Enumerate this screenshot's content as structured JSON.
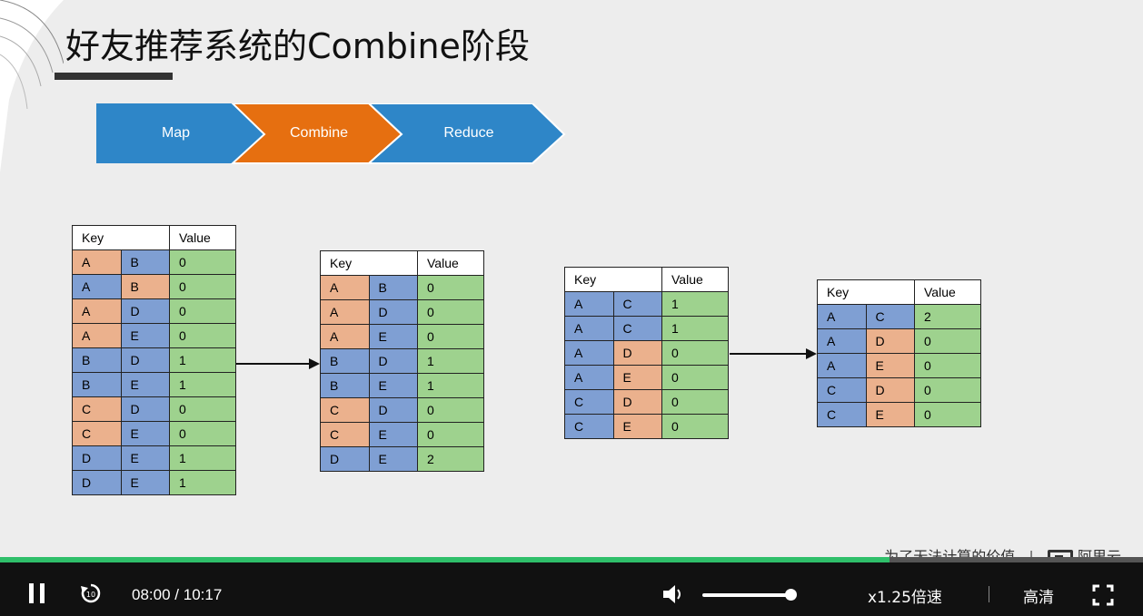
{
  "slide": {
    "title": "好友推荐系统的Combine阶段",
    "flow_steps": [
      "Map",
      "Combine",
      "Reduce"
    ],
    "colors": {
      "step_blue": "#2e86c8",
      "step_orange": "#e66f10",
      "cell_blue": "#7f9fd3",
      "cell_orange": "#ebb18d",
      "cell_green": "#9ed28e"
    },
    "tables": [
      {
        "header_key": "Key",
        "header_value": "Value",
        "rows": [
          {
            "k1": "A",
            "c1": "o",
            "k2": "B",
            "c2": "b",
            "v": "0"
          },
          {
            "k1": "A",
            "c1": "b",
            "k2": "B",
            "c2": "o",
            "v": "0"
          },
          {
            "k1": "A",
            "c1": "o",
            "k2": "D",
            "c2": "b",
            "v": "0"
          },
          {
            "k1": "A",
            "c1": "o",
            "k2": "E",
            "c2": "b",
            "v": "0"
          },
          {
            "k1": "B",
            "c1": "b",
            "k2": "D",
            "c2": "b",
            "v": "1"
          },
          {
            "k1": "B",
            "c1": "b",
            "k2": "E",
            "c2": "b",
            "v": "1"
          },
          {
            "k1": "C",
            "c1": "o",
            "k2": "D",
            "c2": "b",
            "v": "0"
          },
          {
            "k1": "C",
            "c1": "o",
            "k2": "E",
            "c2": "b",
            "v": "0"
          },
          {
            "k1": "D",
            "c1": "b",
            "k2": "E",
            "c2": "b",
            "v": "1"
          },
          {
            "k1": "D",
            "c1": "b",
            "k2": "E",
            "c2": "b",
            "v": "1"
          }
        ]
      },
      {
        "header_key": "Key",
        "header_value": "Value",
        "rows": [
          {
            "k1": "A",
            "c1": "o",
            "k2": "B",
            "c2": "b",
            "v": "0"
          },
          {
            "k1": "A",
            "c1": "o",
            "k2": "D",
            "c2": "b",
            "v": "0"
          },
          {
            "k1": "A",
            "c1": "o",
            "k2": "E",
            "c2": "b",
            "v": "0"
          },
          {
            "k1": "B",
            "c1": "b",
            "k2": "D",
            "c2": "b",
            "v": "1"
          },
          {
            "k1": "B",
            "c1": "b",
            "k2": "E",
            "c2": "b",
            "v": "1"
          },
          {
            "k1": "C",
            "c1": "o",
            "k2": "D",
            "c2": "b",
            "v": "0"
          },
          {
            "k1": "C",
            "c1": "o",
            "k2": "E",
            "c2": "b",
            "v": "0"
          },
          {
            "k1": "D",
            "c1": "b",
            "k2": "E",
            "c2": "b",
            "v": "2"
          }
        ]
      },
      {
        "header_key": "Key",
        "header_value": "Value",
        "rows": [
          {
            "k1": "A",
            "c1": "b",
            "k2": "C",
            "c2": "b",
            "v": "1"
          },
          {
            "k1": "A",
            "c1": "b",
            "k2": "C",
            "c2": "b",
            "v": "1"
          },
          {
            "k1": "A",
            "c1": "b",
            "k2": "D",
            "c2": "o",
            "v": "0"
          },
          {
            "k1": "A",
            "c1": "b",
            "k2": "E",
            "c2": "o",
            "v": "0"
          },
          {
            "k1": "C",
            "c1": "b",
            "k2": "D",
            "c2": "o",
            "v": "0"
          },
          {
            "k1": "C",
            "c1": "b",
            "k2": "E",
            "c2": "o",
            "v": "0"
          }
        ]
      },
      {
        "header_key": "Key",
        "header_value": "Value",
        "rows": [
          {
            "k1": "A",
            "c1": "b",
            "k2": "C",
            "c2": "b",
            "v": "2"
          },
          {
            "k1": "A",
            "c1": "b",
            "k2": "D",
            "c2": "o",
            "v": "0"
          },
          {
            "k1": "A",
            "c1": "b",
            "k2": "E",
            "c2": "o",
            "v": "0"
          },
          {
            "k1": "C",
            "c1": "b",
            "k2": "D",
            "c2": "o",
            "v": "0"
          },
          {
            "k1": "C",
            "c1": "b",
            "k2": "E",
            "c2": "o",
            "v": "0"
          }
        ]
      }
    ],
    "watermark": "为了无法计算的价值",
    "brand": "阿里云"
  },
  "player": {
    "current_time": "08:00",
    "time_separator": "/",
    "duration": "10:17",
    "speed": "x1.25倍速",
    "quality": "高清",
    "progress": 0.778,
    "volume": 0.95,
    "icons": [
      "pause-icon",
      "replay-10-icon",
      "volume-icon",
      "fullscreen-icon"
    ]
  }
}
